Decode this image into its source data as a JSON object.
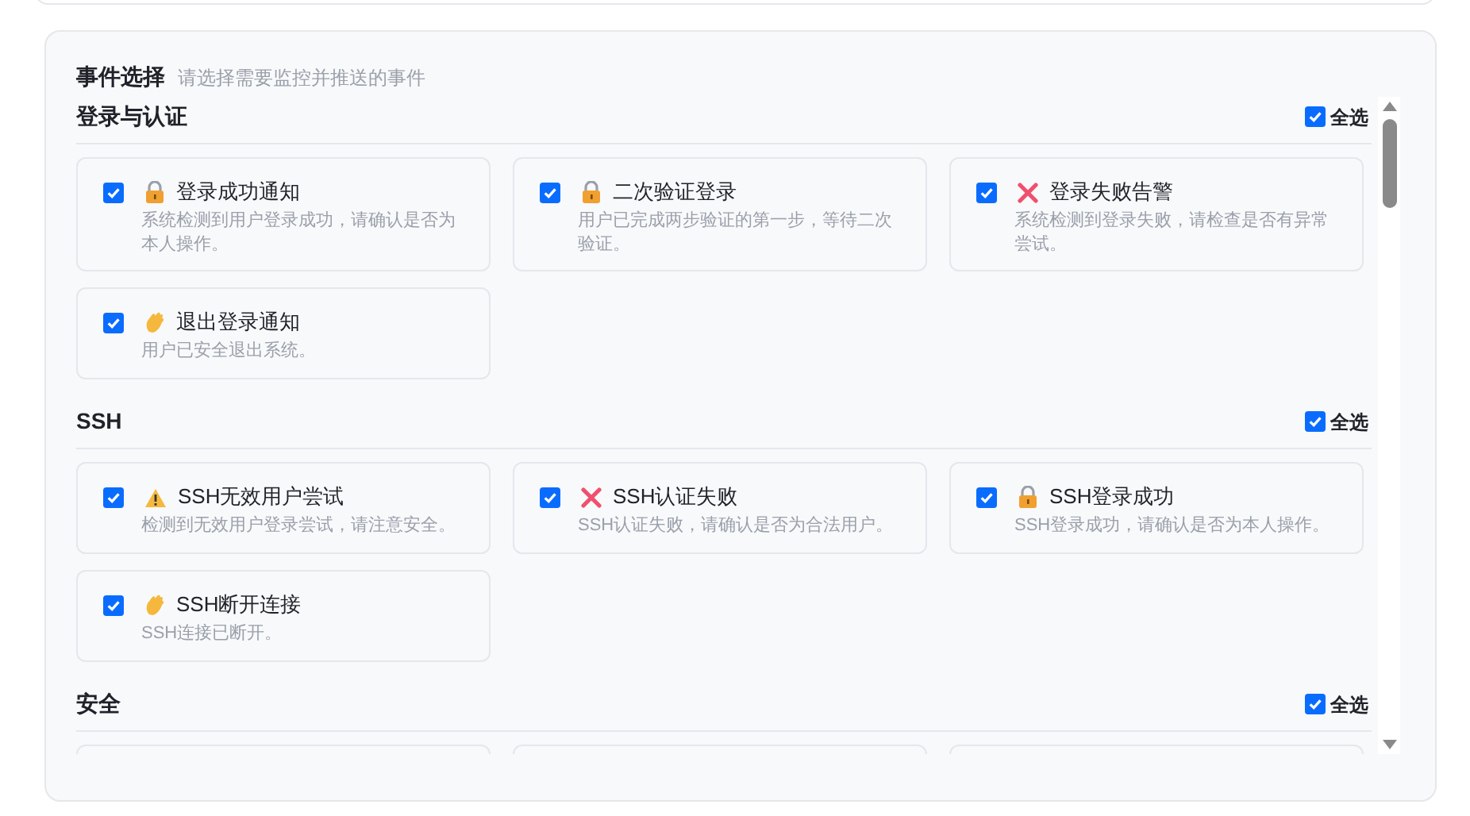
{
  "panel": {
    "title": "事件选择",
    "hint": "请选择需要监控并推送的事件"
  },
  "sections": [
    {
      "title": "登录与认证",
      "select_all": {
        "label": "全选",
        "checked": true
      },
      "events": [
        {
          "kind": "lock",
          "title": "登录成功通知",
          "description": "系统检测到用户登录成功，请确认是否为本人操作。",
          "checked": true
        },
        {
          "kind": "lock",
          "title": "二次验证登录",
          "description": "用户已完成两步验证的第一步，等待二次验证。",
          "checked": true
        },
        {
          "kind": "cross",
          "title": "登录失败告警",
          "description": "系统检测到登录失败，请检查是否有异常尝试。",
          "checked": true
        },
        {
          "kind": "wave",
          "title": "退出登录通知",
          "description": "用户已安全退出系统。",
          "checked": true
        }
      ]
    },
    {
      "title": "SSH",
      "select_all": {
        "label": "全选",
        "checked": true
      },
      "events": [
        {
          "kind": "warning",
          "title": "SSH无效用户尝试",
          "description": "检测到无效用户登录尝试，请注意安全。",
          "checked": true
        },
        {
          "kind": "cross",
          "title": "SSH认证失败",
          "description": "SSH认证失败，请确认是否为合法用户。",
          "checked": true
        },
        {
          "kind": "lock",
          "title": "SSH登录成功",
          "description": "SSH登录成功，请确认是否为本人操作。",
          "checked": true
        },
        {
          "kind": "wave",
          "title": "SSH断开连接",
          "description": "SSH连接已断开。",
          "checked": true
        }
      ]
    },
    {
      "title": "安全",
      "select_all": {
        "label": "全选",
        "checked": true
      }
    }
  ]
}
